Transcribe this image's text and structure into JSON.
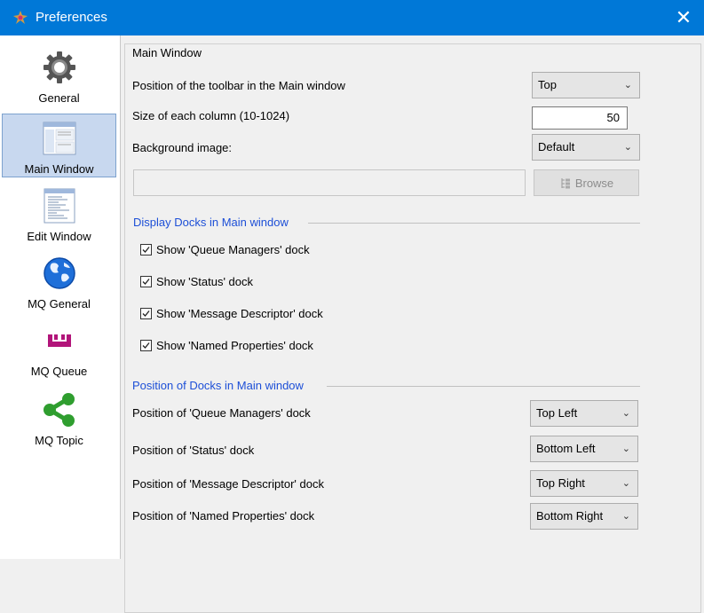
{
  "window": {
    "title": "Preferences",
    "close_glyph": "✕"
  },
  "sidebar": {
    "items": [
      {
        "label": "General",
        "icon": "gear-icon",
        "selected": false
      },
      {
        "label": "Main Window",
        "icon": "main-window-thumbnail-icon",
        "selected": true
      },
      {
        "label": "Edit Window",
        "icon": "edit-window-thumbnail-icon",
        "selected": false
      },
      {
        "label": "MQ General",
        "icon": "globe-icon",
        "selected": false
      },
      {
        "label": "MQ Queue",
        "icon": "queue-icon",
        "selected": false
      },
      {
        "label": "MQ Topic",
        "icon": "topic-share-icon",
        "selected": false
      }
    ]
  },
  "main": {
    "group_title": "Main Window",
    "toolbar_position": {
      "label": "Position of the toolbar in the Main window",
      "value": "Top"
    },
    "column_size": {
      "label": "Size of each column (10-1024)",
      "value": "50"
    },
    "background_image": {
      "label": "Background image:",
      "value": "Default",
      "path": ""
    },
    "browse_label": "Browse",
    "display_docks": {
      "title": "Display Docks in Main window",
      "items": [
        {
          "label": "Show 'Queue Managers' dock",
          "checked": true
        },
        {
          "label": "Show 'Status' dock",
          "checked": true
        },
        {
          "label": "Show 'Message Descriptor' dock",
          "checked": true
        },
        {
          "label": "Show 'Named Properties' dock",
          "checked": true
        }
      ]
    },
    "dock_positions": {
      "title": "Position of Docks in Main window",
      "items": [
        {
          "label": "Position of 'Queue Managers' dock",
          "value": "Top Left"
        },
        {
          "label": "Position of 'Status' dock",
          "value": "Bottom Left"
        },
        {
          "label": "Position of 'Message Descriptor' dock",
          "value": "Top Right"
        },
        {
          "label": "Position of 'Named Properties' dock",
          "value": "Bottom Right"
        }
      ]
    }
  },
  "colors": {
    "titlebar": "#0078d7",
    "section_title": "#1d4fd7",
    "selection": "#c8d8ef"
  }
}
